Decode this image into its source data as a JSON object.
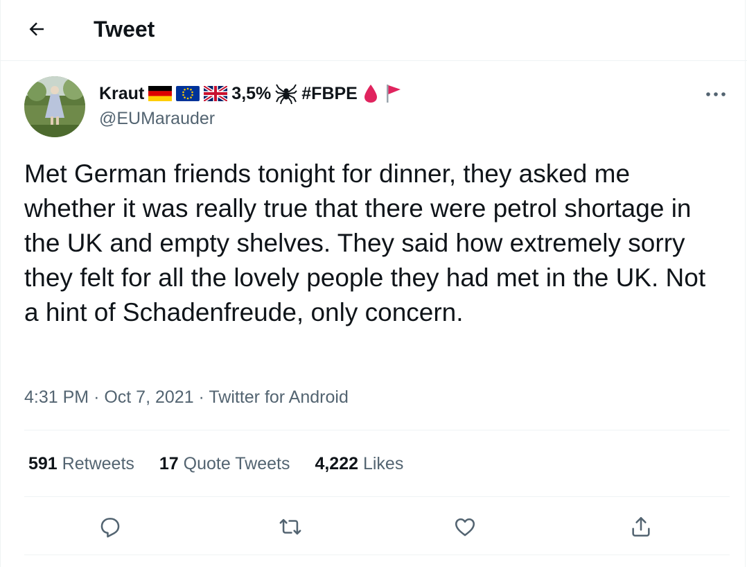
{
  "header": {
    "title": "Tweet"
  },
  "author": {
    "display_name": "Kraut",
    "name_suffix_1": "3,5%",
    "name_suffix_2": "#FBPE",
    "handle": "@EUMarauder"
  },
  "tweet": {
    "text": "Met German friends tonight for dinner, they asked me whether it was really true that there were petrol shortage in the UK and empty shelves. They said how extremely sorry they felt for all the lovely people they had met in the UK. Not a hint of Schadenfreude, only concern.",
    "time": "4:31 PM",
    "separator": "·",
    "date": "Oct 7, 2021",
    "source": "Twitter for Android"
  },
  "stats": {
    "retweets_count": "591",
    "retweets_label": "Retweets",
    "quotes_count": "17",
    "quotes_label": "Quote Tweets",
    "likes_count": "4,222",
    "likes_label": "Likes"
  },
  "icons": {
    "back": "arrow-left-icon",
    "more": "more-horizontal-icon",
    "reply": "reply-icon",
    "retweet": "retweet-icon",
    "like": "heart-icon",
    "share": "share-icon"
  },
  "colors": {
    "text": "#0f1419",
    "secondary": "#536471",
    "border": "#eff3f4",
    "drop": "#e0245e",
    "flag": "#e0245e"
  }
}
